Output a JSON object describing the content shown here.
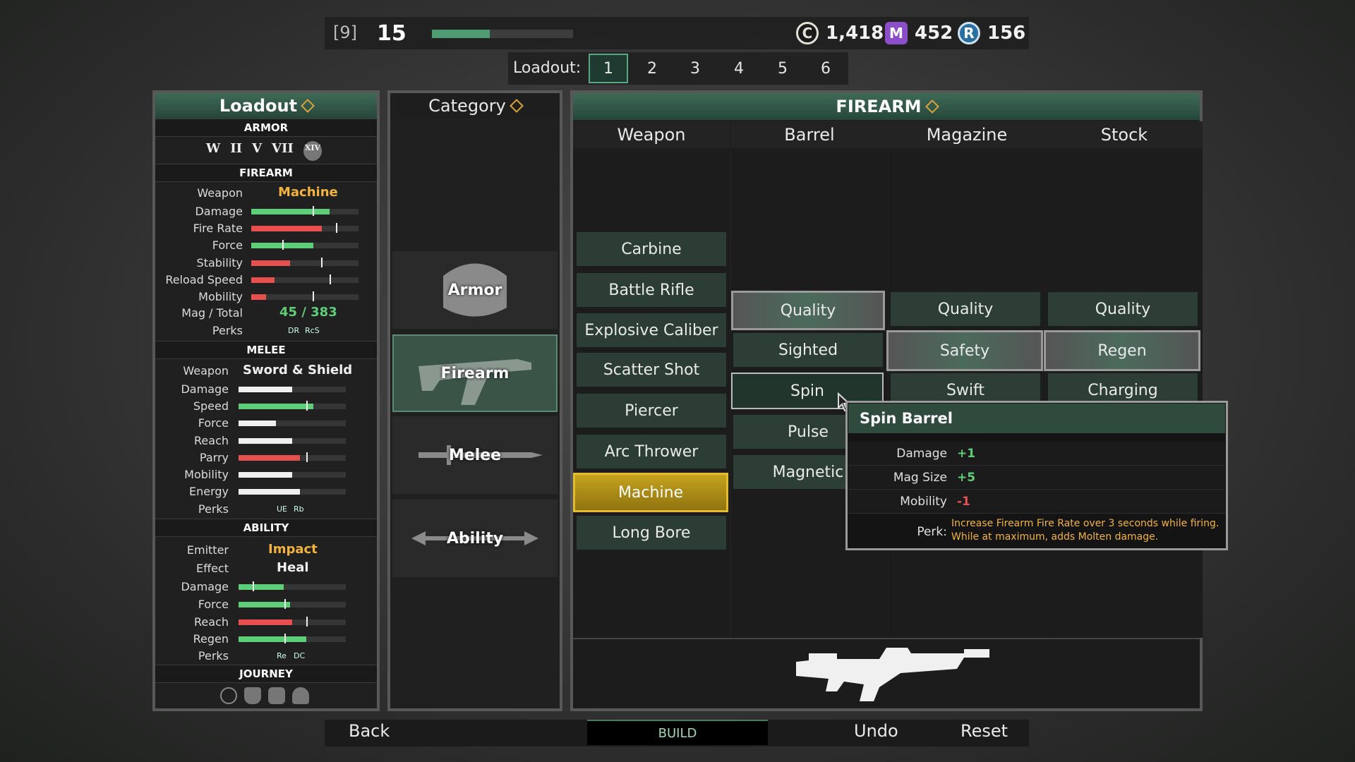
{
  "topbar": {
    "level_bracket": "[9]",
    "level": "15",
    "xp_progress": 0.41,
    "credits": "1,418",
    "credits_icon": "C",
    "mats": "452",
    "mats_icon": "M",
    "rep": "156",
    "rep_icon": "R"
  },
  "loadout_selector": {
    "label": "Loadout:",
    "tabs": [
      "1",
      "2",
      "3",
      "4",
      "5",
      "6"
    ],
    "active": "1"
  },
  "left": {
    "title": "Loadout",
    "armor": {
      "section": "ARMOR",
      "icons": [
        "W",
        "II",
        "V",
        "VII",
        "XIV"
      ]
    },
    "firearm": {
      "section": "FIREARM",
      "weapon_label": "Weapon",
      "weapon": "Machine",
      "stats": [
        {
          "label": "Damage",
          "value": 0.73,
          "marker": 0.57,
          "color": "#5fce78"
        },
        {
          "label": "Fire Rate",
          "value": 0.66,
          "marker": 0.79,
          "color": "#e85050"
        },
        {
          "label": "Force",
          "value": 0.58,
          "marker": 0.29,
          "color": "#5fce78"
        },
        {
          "label": "Stability",
          "value": 0.36,
          "marker": 0.65,
          "color": "#e85050"
        },
        {
          "label": "Reload Speed",
          "value": 0.22,
          "marker": 0.73,
          "color": "#e85050"
        },
        {
          "label": "Mobility",
          "value": 0.14,
          "marker": 0.57,
          "color": "#e85050"
        }
      ],
      "mag_label": "Mag / Total",
      "mag": "45 / 383",
      "perks_label": "Perks",
      "perks": [
        "DR",
        "RcS"
      ]
    },
    "melee": {
      "section": "MELEE",
      "weapon_label": "Weapon",
      "weapon": "Sword & Shield",
      "stats": [
        {
          "label": "Damage",
          "value": 0.5,
          "color": "#f0f0f0"
        },
        {
          "label": "Speed",
          "value": 0.7,
          "marker": 0.63,
          "color": "#5fce78"
        },
        {
          "label": "Force",
          "value": 0.35,
          "color": "#f0f0f0"
        },
        {
          "label": "Reach",
          "value": 0.5,
          "color": "#f0f0f0"
        },
        {
          "label": "Parry",
          "value": 0.57,
          "marker": 0.63,
          "color": "#e85050"
        },
        {
          "label": "Mobility",
          "value": 0.5,
          "color": "#f0f0f0"
        },
        {
          "label": "Energy",
          "value": 0.57,
          "color": "#f0f0f0"
        }
      ],
      "perks_label": "Perks",
      "perks": [
        "UE",
        "Rb"
      ]
    },
    "ability": {
      "section": "ABILITY",
      "emitter_label": "Emitter",
      "emitter": "Impact",
      "effect_label": "Effect",
      "effect": "Heal",
      "stats": [
        {
          "label": "Damage",
          "value": 0.42,
          "marker": 0.13,
          "color": "#5fce78"
        },
        {
          "label": "Force",
          "value": 0.48,
          "marker": 0.43,
          "color": "#5fce78"
        },
        {
          "label": "Reach",
          "value": 0.5,
          "marker": 0.63,
          "color": "#e85050"
        },
        {
          "label": "Regen",
          "value": 0.63,
          "marker": 0.43,
          "color": "#5fce78"
        }
      ],
      "perks_label": "Perks",
      "perks": [
        "Re",
        "DC"
      ]
    },
    "journey": {
      "section": "JOURNEY"
    }
  },
  "category": {
    "title": "Category",
    "items": [
      "Armor",
      "Firearm",
      "Melee",
      "Ability"
    ],
    "active": "Firearm"
  },
  "main": {
    "title": "FIREARM",
    "columns": {
      "weapon": "Weapon",
      "barrel": "Barrel",
      "magazine": "Magazine",
      "stock": "Stock"
    },
    "weapons": [
      "Carbine",
      "Battle Rifle",
      "Explosive Caliber",
      "Scatter Shot",
      "Piercer",
      "Arc Thrower",
      "Machine",
      "Long Bore"
    ],
    "barrels": [
      "Quality",
      "Sighted",
      "Spin",
      "Pulse",
      "Magnetic"
    ],
    "magazines": [
      "Quality",
      "Safety",
      "Swift"
    ],
    "stocks": [
      "Quality",
      "Regen",
      "Charging"
    ]
  },
  "tooltip": {
    "title": "Spin Barrel",
    "rows": [
      {
        "label": "Damage",
        "value": "+1",
        "color": "#5fce78"
      },
      {
        "label": "Mag Size",
        "value": "+5",
        "color": "#5fce78"
      },
      {
        "label": "Mobility",
        "value": "-1",
        "color": "#e85050"
      }
    ],
    "perk_label": "Perk:",
    "perk_line1": "Increase Firearm Fire Rate over 3 seconds while firing.",
    "perk_line2": "While at maximum, adds Molten damage."
  },
  "bottom": {
    "back": "Back",
    "build": "BUILD",
    "undo": "Undo",
    "reset": "Reset"
  }
}
